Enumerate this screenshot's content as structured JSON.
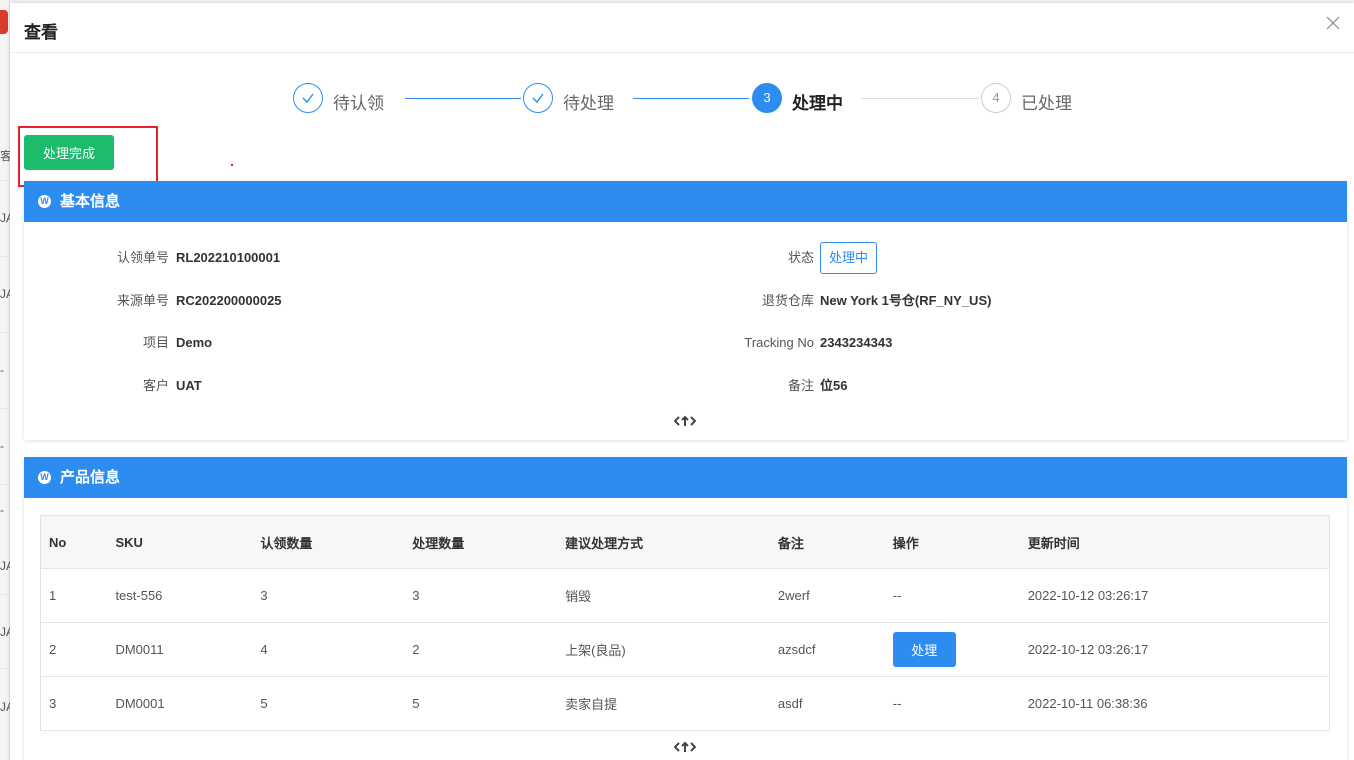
{
  "background": {
    "fragments": [
      "客",
      "JA",
      "JA",
      "-",
      "-",
      "-",
      "JA",
      "JA",
      "JA"
    ]
  },
  "modal": {
    "title": "查看",
    "close_icon": "close-icon"
  },
  "steps": [
    {
      "label": "待认领",
      "state": "finished",
      "icon": "check-icon"
    },
    {
      "label": "待处理",
      "state": "finished",
      "icon": "check-icon"
    },
    {
      "label": "处理中",
      "state": "active",
      "number": "3"
    },
    {
      "label": "已处理",
      "state": "wait",
      "number": "4"
    }
  ],
  "actions": {
    "complete_label": "处理完成"
  },
  "basic_info": {
    "title": "基本信息",
    "fields": {
      "claim_no_label": "认领单号",
      "claim_no": "RL202210100001",
      "source_no_label": "来源单号",
      "source_no": "RC202200000025",
      "project_label": "项目",
      "project": "Demo",
      "customer_label": "客户",
      "customer": "UAT",
      "status_label": "状态",
      "status": "处理中",
      "warehouse_label": "退货仓库",
      "warehouse": "New York 1号仓(RF_NY_US)",
      "tracking_label": "Tracking No",
      "tracking": "2343234343",
      "remark_label": "备注",
      "remark": "位56"
    },
    "collapse_icon": "collapse-toggle-icon"
  },
  "product_info": {
    "title": "产品信息",
    "columns": [
      "No",
      "SKU",
      "认领数量",
      "处理数量",
      "建议处理方式",
      "备注",
      "操作",
      "更新时间"
    ],
    "rows": [
      {
        "no": "1",
        "sku": "test-556",
        "claim_qty": "3",
        "process_qty": "3",
        "suggest": "销毁",
        "remark": "2werf",
        "op": "--",
        "updated": "2022-10-12 03:26:17"
      },
      {
        "no": "2",
        "sku": "DM0011",
        "claim_qty": "4",
        "process_qty": "2",
        "suggest": "上架(良品)",
        "remark": "azsdcf",
        "op": "处理",
        "updated": "2022-10-12 03:26:17"
      },
      {
        "no": "3",
        "sku": "DM0001",
        "claim_qty": "5",
        "process_qty": "5",
        "suggest": "卖家自提",
        "remark": "asdf",
        "op": "--",
        "updated": "2022-10-11 06:38:36"
      }
    ],
    "collapse_icon": "collapse-toggle-icon"
  },
  "colors": {
    "primary": "#2d8cf0",
    "success": "#1dbb6c",
    "highlight": "#e8222a"
  }
}
